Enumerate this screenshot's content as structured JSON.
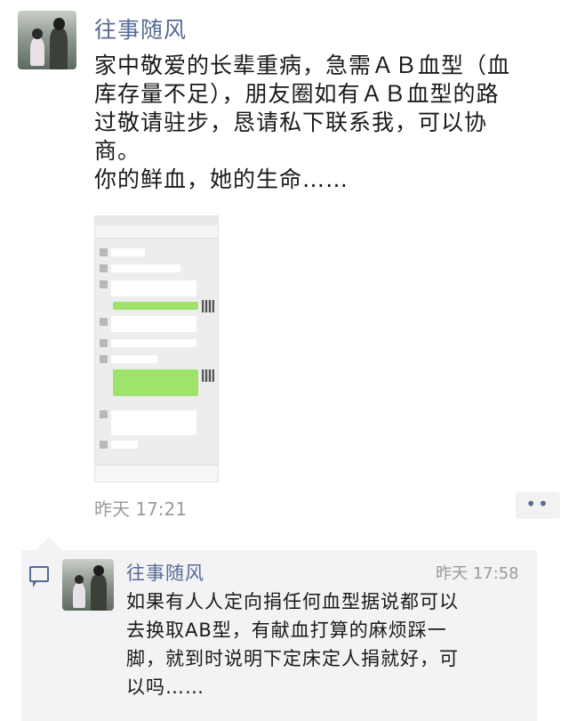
{
  "post": {
    "nickname": "往事随风",
    "lines": [
      "家中敬爱的长辈重病，急需ＡＢ血型（血",
      "库存量不足），朋友圈如有ＡＢ血型的路",
      "过敬请驻步，恳请私下联系我，可以协",
      "商。",
      "你的鲜血，她的生命……"
    ],
    "time": "昨天 17:21",
    "more_label": "••",
    "image_icon": "chat-screenshot-thumbnail"
  },
  "comment": {
    "icon": "comment-bubble-icon",
    "nickname": "往事随风",
    "time": "昨天 17:58",
    "lines": [
      "如果有人人定向捐任何血型据说都可以",
      "去换取AB型，有献血打算的麻烦踩一",
      "脚，就到时说明下定床定人捐就好，可",
      "以吗……"
    ]
  },
  "colors": {
    "link_blue": "#576b95",
    "comment_bg": "#f3f3f5",
    "bubble_green": "#9fe36b"
  }
}
